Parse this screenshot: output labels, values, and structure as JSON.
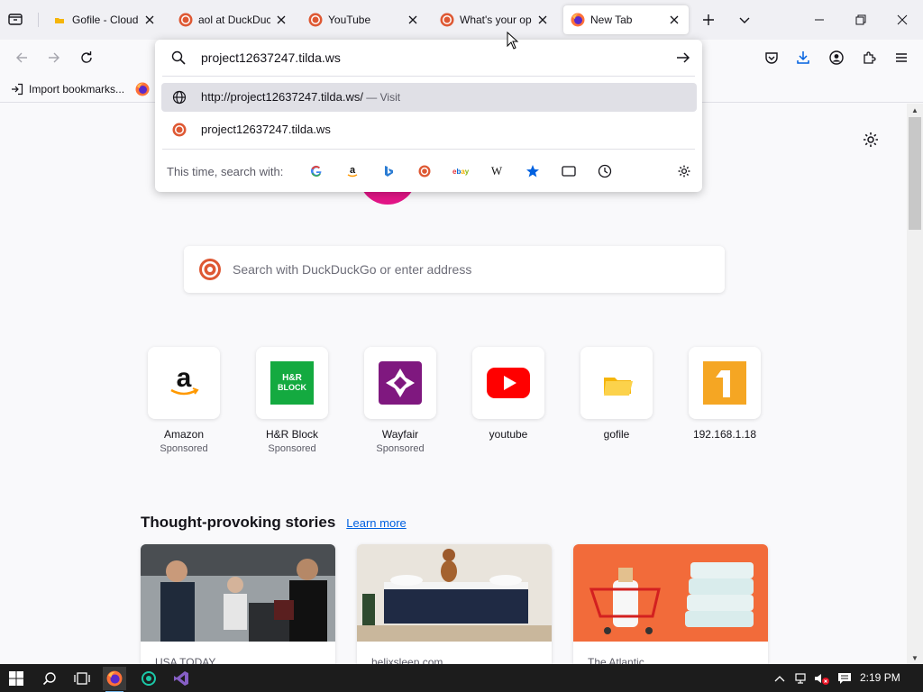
{
  "tabs": [
    {
      "title": "Gofile - Cloud Storage",
      "favicon": "gofile-icon"
    },
    {
      "title": "aol at DuckDuckGo",
      "favicon": "duckduckgo-icon"
    },
    {
      "title": "YouTube",
      "favicon": "duckduckgo-icon"
    },
    {
      "title": "What's your opinion",
      "favicon": "duckduckgo-icon"
    },
    {
      "title": "New Tab",
      "favicon": "firefox-icon",
      "active": true
    }
  ],
  "urlbar": {
    "value": "project12637247.tilda.ws"
  },
  "suggestions": [
    {
      "text": "http://project12637247.tilda.ws/",
      "action": "Visit",
      "icon": "globe-icon",
      "selected": true
    },
    {
      "text": "project12637247.tilda.ws",
      "action": "",
      "icon": "duckduckgo-icon",
      "selected": false
    }
  ],
  "search_with": {
    "label": "This time, search with:",
    "engines": [
      "google",
      "amazon",
      "bing",
      "duckduckgo",
      "ebay",
      "wikipedia",
      "bookmarks",
      "tabs",
      "history"
    ]
  },
  "bookmarks": {
    "import_label": "Import bookmarks..."
  },
  "newtab": {
    "search_placeholder": "Search with DuckDuckGo or enter address",
    "top_sites": [
      {
        "name": "Amazon",
        "sponsored": "Sponsored"
      },
      {
        "name": "H&R Block",
        "sponsored": "Sponsored",
        "logo_text": "H&R\nBLOCK"
      },
      {
        "name": "Wayfair",
        "sponsored": "Sponsored"
      },
      {
        "name": "youtube",
        "sponsored": ""
      },
      {
        "name": "gofile",
        "sponsored": ""
      },
      {
        "name": "192.168.1.18",
        "sponsored": ""
      }
    ],
    "stories_title": "Thought-provoking stories",
    "stories_link": "Learn more",
    "stories": [
      {
        "source": "USA TODAY"
      },
      {
        "source": "helixsleep.com"
      },
      {
        "source": "The Atlantic"
      }
    ]
  },
  "taskbar": {
    "time": "2:19 PM"
  },
  "colors": {
    "accent": "#0061e0",
    "firefox_pink": "#e31587",
    "taskbar": "#1c1c1c"
  }
}
